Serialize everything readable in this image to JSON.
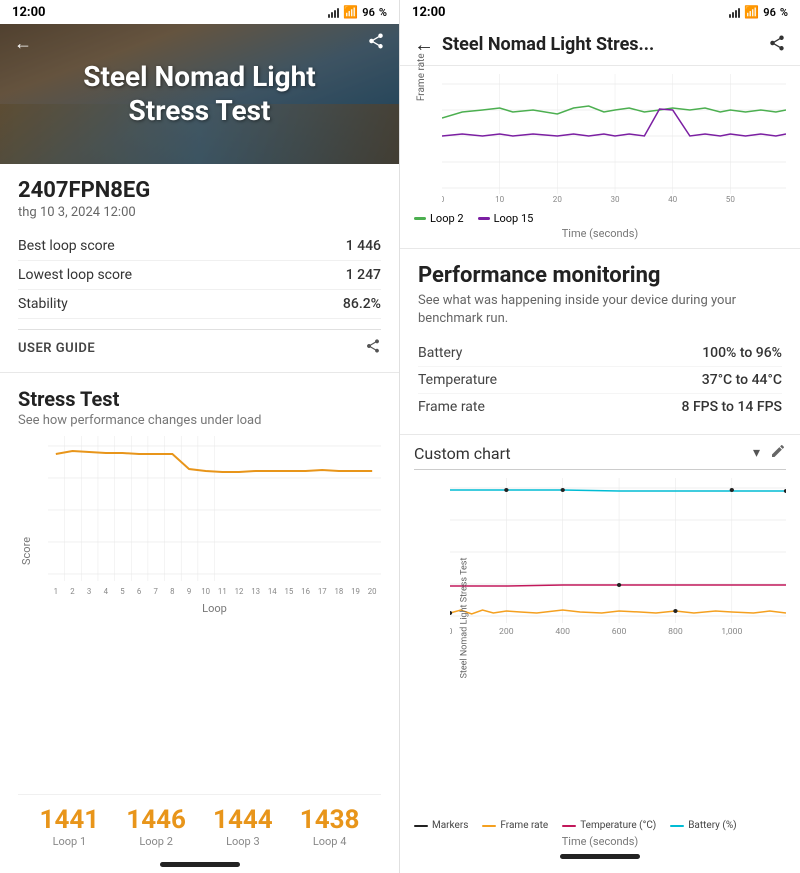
{
  "left": {
    "status_bar": {
      "time": "12:00",
      "battery_pct": "96"
    },
    "hero": {
      "title": "Steel Nomad Light\nStress Test",
      "back_label": "←",
      "share_label": "⋮"
    },
    "info": {
      "device_id": "2407FPN8EG",
      "date": "thg 10 3, 2024 12:00",
      "best_loop_label": "Best loop score",
      "best_loop_value": "1 446",
      "lowest_loop_label": "Lowest loop score",
      "lowest_loop_value": "1 247",
      "stability_label": "Stability",
      "stability_value": "86.2%",
      "user_guide_label": "USER GUIDE"
    },
    "stress": {
      "title": "Stress Test",
      "subtitle": "See how performance changes under load",
      "y_label": "Score",
      "x_label": "Loop"
    },
    "scores": [
      {
        "value": "1441",
        "loop": "Loop 1"
      },
      {
        "value": "1446",
        "loop": "Loop 2"
      },
      {
        "value": "1444",
        "loop": "Loop 3"
      },
      {
        "value": "1438",
        "loop": "Loop 4"
      }
    ]
  },
  "right": {
    "status_bar": {
      "time": "12:00",
      "battery_pct": "96"
    },
    "header": {
      "title": "Steel Nomad Light Stres...",
      "back_label": "←",
      "share_label": "⋮"
    },
    "frame_chart": {
      "y_label": "Frame rate",
      "x_label": "Time (seconds)",
      "legend": [
        {
          "label": "Loop 2",
          "color": "#4CAF50"
        },
        {
          "label": "Loop 15",
          "color": "#7B1FA2"
        }
      ]
    },
    "performance": {
      "title": "Performance monitoring",
      "desc": "See what was happening inside your device during your benchmark run.",
      "rows": [
        {
          "key": "Battery",
          "value": "100% to 96%"
        },
        {
          "key": "Temperature",
          "value": "37°C to 44°C"
        },
        {
          "key": "Frame rate",
          "value": "8 FPS to 14 FPS"
        }
      ]
    },
    "custom_chart": {
      "label": "Custom chart",
      "x_label": "Time (seconds)",
      "y_axis_label": "Steel Nomad Light Stress Test",
      "legend": [
        {
          "label": "Markers",
          "color": "#222222"
        },
        {
          "label": "Frame rate",
          "color": "#F4A020"
        },
        {
          "label": "Temperature (°C)",
          "color": "#C2185B"
        },
        {
          "label": "Battery (%)",
          "color": "#00BCD4"
        }
      ]
    }
  },
  "icons": {
    "back": "←",
    "share": "share",
    "dropdown": "▾",
    "edit": "✏"
  }
}
